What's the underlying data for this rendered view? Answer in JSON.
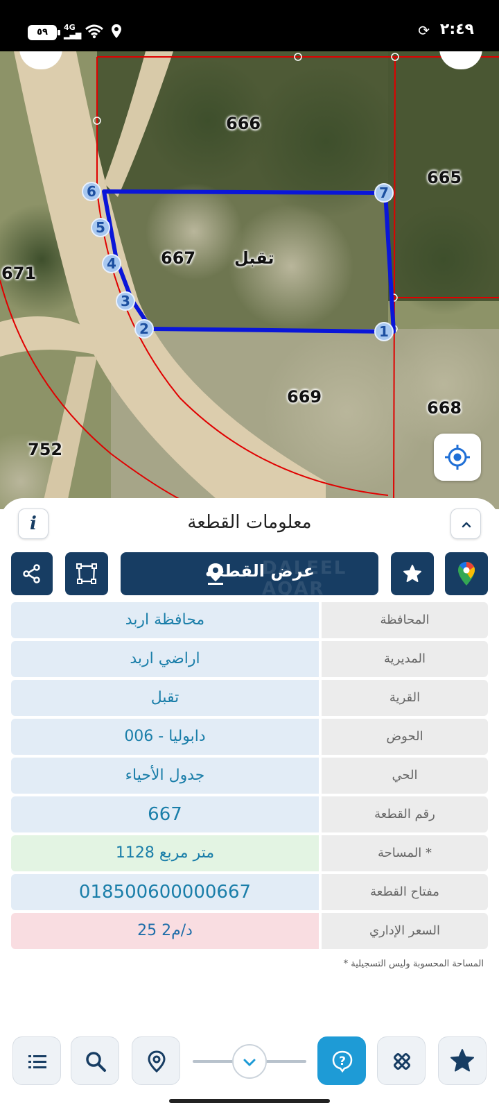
{
  "status_bar": {
    "time": "٢:٤٩",
    "battery": "٥٩",
    "network": "4G"
  },
  "map": {
    "parcels": [
      "666",
      "665",
      "667",
      "671",
      "669",
      "668",
      "752"
    ],
    "village_label": "تقبل",
    "vertices": [
      "1",
      "2",
      "3",
      "4",
      "5",
      "6",
      "7"
    ],
    "colors": {
      "boundary": "#e00000",
      "selected_parcel": "#0a16d8"
    }
  },
  "panel": {
    "title": "معلومات القطعة",
    "show_parcel_label": "عرض القطعة",
    "watermark": "DALEEL AQAR",
    "rows": [
      {
        "key": "المحافظة",
        "value": "محافظة اربد"
      },
      {
        "key": "المديرية",
        "value": "اراضي اربد"
      },
      {
        "key": "القرية",
        "value": "تقبل"
      },
      {
        "key": "الحوض",
        "value": "دابوليا - 006"
      },
      {
        "key": "الحي",
        "value": "جدول الأحياء"
      },
      {
        "key": "رقم القطعة",
        "value": "667"
      },
      {
        "key": "المساحة *",
        "value": "1128  متر مربع"
      },
      {
        "key": "مفتاح القطعة",
        "value": "018500600000667"
      },
      {
        "key": "السعر الإداري",
        "value": "25 د/م2"
      }
    ],
    "footnote": "* المساحة المحسوبة وليس التسجيلية"
  },
  "icons": {
    "share": "share-icon",
    "polygon": "polygon-icon",
    "pin": "location-pin-icon",
    "star": "star-icon",
    "gmaps": "google-maps-icon",
    "info": "info-icon",
    "chevron": "chevron-up-icon"
  }
}
